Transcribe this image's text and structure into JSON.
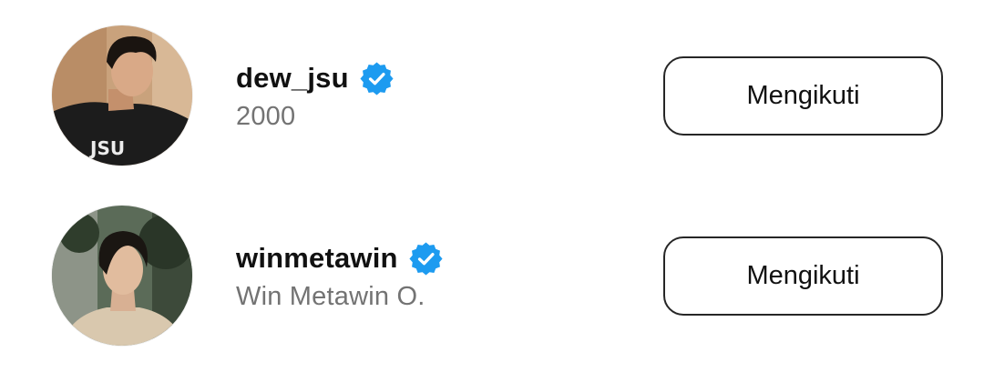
{
  "accounts": [
    {
      "username": "dew_jsu",
      "subtitle": "2000",
      "verified": true,
      "button_label": "Mengikuti",
      "shirt_text": "JSU"
    },
    {
      "username": "winmetawin",
      "subtitle": "Win Metawin O.",
      "verified": true,
      "button_label": "Mengikuti"
    }
  ],
  "colors": {
    "verified_badge": "#1D9BF0",
    "button_border": "#262626",
    "username": "#111111",
    "subtitle": "#737373"
  }
}
